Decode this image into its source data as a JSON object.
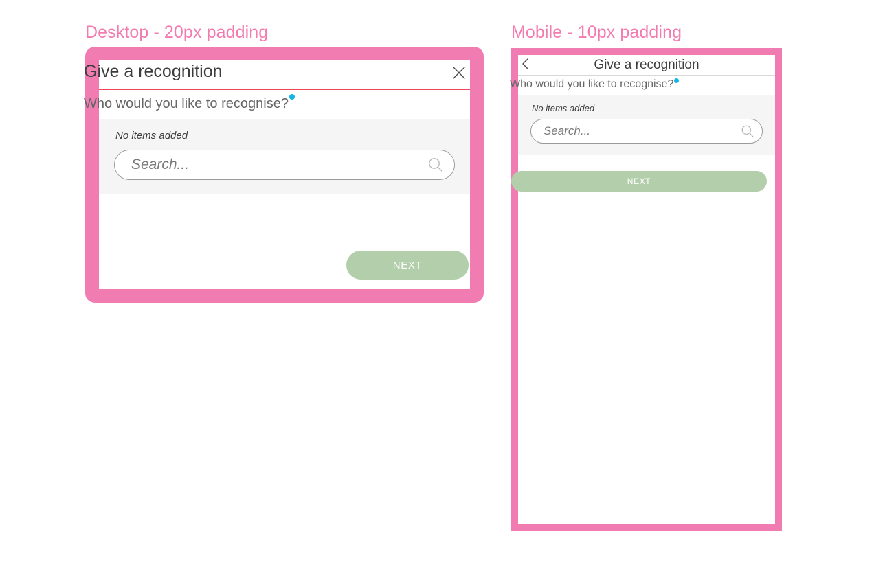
{
  "captions": {
    "desktop": "Desktop - 20px padding",
    "mobile": "Mobile - 10px padding"
  },
  "colors": {
    "frame_pink": "#f07cb2",
    "caption_pink": "#f47bb0",
    "header_rule_red": "#f2455c",
    "required_dot_cyan": "#12b5e5",
    "next_button_green": "#b3ceab",
    "panel_gray": "#f5f5f5",
    "title_text": "#3c3c3c",
    "label_text": "#666666"
  },
  "desktop": {
    "title": "Give a recognition",
    "close_icon": "close-icon",
    "question": "Who would you like to recognise?",
    "required_marker": "required-dot",
    "empty_state": "No items added",
    "search": {
      "value": "",
      "placeholder": "Search...",
      "icon": "search-icon"
    },
    "next_label": "NEXT"
  },
  "mobile": {
    "back_icon": "chevron-left-icon",
    "title": "Give a recognition",
    "question": "Who would you like to recognise?",
    "required_marker": "required-dot",
    "empty_state": "No items added",
    "search": {
      "value": "",
      "placeholder": "Search...",
      "icon": "search-icon"
    },
    "next_label": "NEXT"
  }
}
